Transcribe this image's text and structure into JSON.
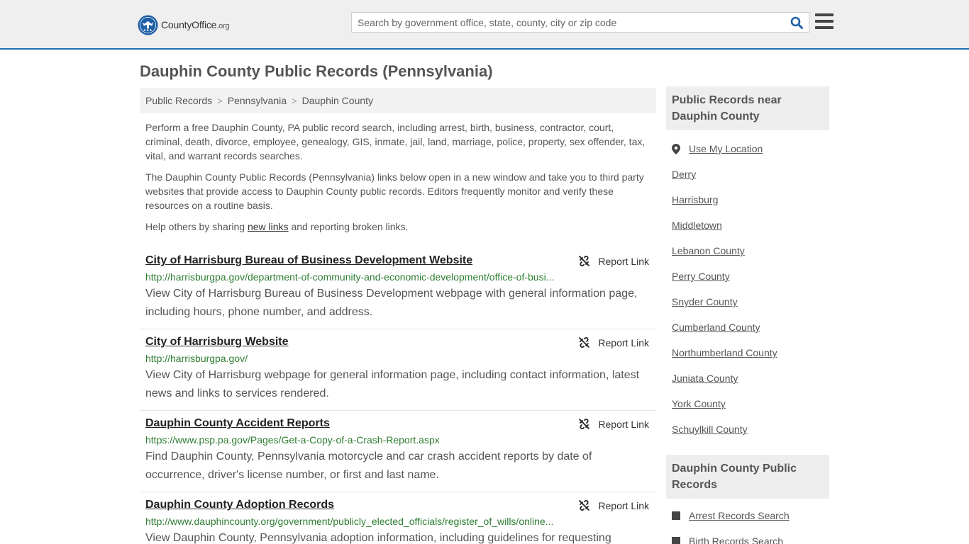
{
  "header": {
    "logo_text_main": "CountyOffice",
    "logo_text_org": ".org",
    "search_placeholder": "Search by government office, state, county, city or zip code"
  },
  "page_title": "Dauphin County Public Records (Pennsylvania)",
  "breadcrumb": [
    "Public Records",
    "Pennsylvania",
    "Dauphin County"
  ],
  "intro": {
    "p1": "Perform a free Dauphin County, PA public record search, including arrest, birth, business, contractor, court, criminal, death, divorce, employee, genealogy, GIS, inmate, jail, land, marriage, police, property, sex offender, tax, vital, and warrant records searches.",
    "p2": "The Dauphin County Public Records (Pennsylvania) links below open in a new window and take you to third party websites that provide access to Dauphin County public records. Editors frequently monitor and verify these resources on a routine basis.",
    "p3_before": "Help others by sharing ",
    "p3_link": "new links",
    "p3_after": " and reporting broken links."
  },
  "report_label": "Report Link",
  "records": [
    {
      "title": "City of Harrisburg Bureau of Business Development Website",
      "url": "http://harrisburgpa.gov/department-of-community-and-economic-development/office-of-busi...",
      "desc": "View City of Harrisburg Bureau of Business Development webpage with general information page, including hours, phone number, and address."
    },
    {
      "title": "City of Harrisburg Website",
      "url": "http://harrisburgpa.gov/",
      "desc": "View City of Harrisburg webpage for general information page, including contact information, latest news and links to services rendered."
    },
    {
      "title": "Dauphin County Accident Reports",
      "url": "https://www.psp.pa.gov/Pages/Get-a-Copy-of-a-Crash-Report.aspx",
      "desc": "Find Dauphin County, Pennsylvania motorcycle and car crash accident reports by date of occurrence, driver's license number, or first and last name."
    },
    {
      "title": "Dauphin County Adoption Records",
      "url": "http://www.dauphincounty.org/government/publicly_elected_officials/register_of_wills/online...",
      "desc": "View Dauphin County, Pennsylvania adoption information, including guidelines for requesting"
    }
  ],
  "sidebar": {
    "nearby_title": "Public Records near Dauphin County",
    "use_location": "Use My Location",
    "nearby": [
      "Derry",
      "Harrisburg",
      "Middletown",
      "Lebanon County",
      "Perry County",
      "Snyder County",
      "Cumberland County",
      "Northumberland County",
      "Juniata County",
      "York County",
      "Schuylkill County"
    ],
    "records_title": "Dauphin County Public Records",
    "records_links": [
      "Arrest Records Search",
      "Birth Records Search"
    ]
  },
  "colors": {
    "accent": "#1f6fb4",
    "url_green": "#2e7d32",
    "header_bg": "#efefef"
  }
}
